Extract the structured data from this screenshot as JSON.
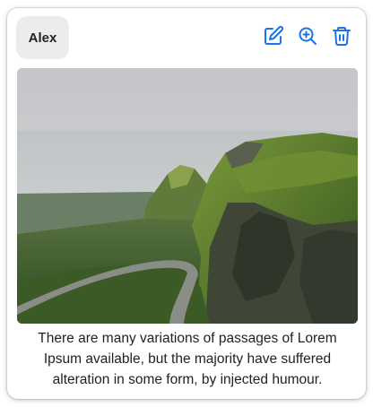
{
  "card": {
    "user_name": "Alex",
    "caption": "There are many variations of passages of Lorem Ipsum available, but the majority have suffered alteration in some form, by injected humour.",
    "image_subject": "mountain-valley-road-landscape",
    "actions": [
      {
        "name": "edit-icon"
      },
      {
        "name": "zoom-in-icon"
      },
      {
        "name": "trash-icon"
      }
    ]
  },
  "colors": {
    "accent": "#1a73e8",
    "chip_bg": "#ececec",
    "text": "#222222"
  }
}
